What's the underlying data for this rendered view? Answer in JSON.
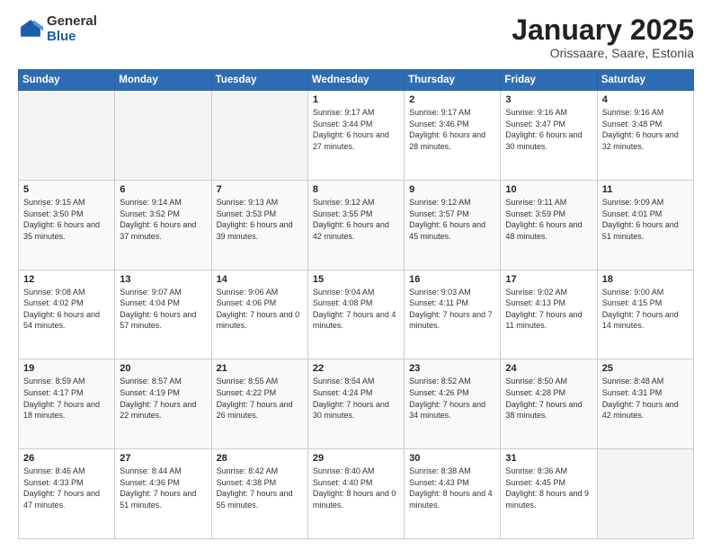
{
  "logo": {
    "general": "General",
    "blue": "Blue"
  },
  "header": {
    "title": "January 2025",
    "location": "Orissaare, Saare, Estonia"
  },
  "weekdays": [
    "Sunday",
    "Monday",
    "Tuesday",
    "Wednesday",
    "Thursday",
    "Friday",
    "Saturday"
  ],
  "weeks": [
    [
      {
        "day": "",
        "sunrise": "",
        "sunset": "",
        "daylight": ""
      },
      {
        "day": "",
        "sunrise": "",
        "sunset": "",
        "daylight": ""
      },
      {
        "day": "",
        "sunrise": "",
        "sunset": "",
        "daylight": ""
      },
      {
        "day": "1",
        "sunrise": "Sunrise: 9:17 AM",
        "sunset": "Sunset: 3:44 PM",
        "daylight": "Daylight: 6 hours and 27 minutes."
      },
      {
        "day": "2",
        "sunrise": "Sunrise: 9:17 AM",
        "sunset": "Sunset: 3:46 PM",
        "daylight": "Daylight: 6 hours and 28 minutes."
      },
      {
        "day": "3",
        "sunrise": "Sunrise: 9:16 AM",
        "sunset": "Sunset: 3:47 PM",
        "daylight": "Daylight: 6 hours and 30 minutes."
      },
      {
        "day": "4",
        "sunrise": "Sunrise: 9:16 AM",
        "sunset": "Sunset: 3:48 PM",
        "daylight": "Daylight: 6 hours and 32 minutes."
      }
    ],
    [
      {
        "day": "5",
        "sunrise": "Sunrise: 9:15 AM",
        "sunset": "Sunset: 3:50 PM",
        "daylight": "Daylight: 6 hours and 35 minutes."
      },
      {
        "day": "6",
        "sunrise": "Sunrise: 9:14 AM",
        "sunset": "Sunset: 3:52 PM",
        "daylight": "Daylight: 6 hours and 37 minutes."
      },
      {
        "day": "7",
        "sunrise": "Sunrise: 9:13 AM",
        "sunset": "Sunset: 3:53 PM",
        "daylight": "Daylight: 6 hours and 39 minutes."
      },
      {
        "day": "8",
        "sunrise": "Sunrise: 9:12 AM",
        "sunset": "Sunset: 3:55 PM",
        "daylight": "Daylight: 6 hours and 42 minutes."
      },
      {
        "day": "9",
        "sunrise": "Sunrise: 9:12 AM",
        "sunset": "Sunset: 3:57 PM",
        "daylight": "Daylight: 6 hours and 45 minutes."
      },
      {
        "day": "10",
        "sunrise": "Sunrise: 9:11 AM",
        "sunset": "Sunset: 3:59 PM",
        "daylight": "Daylight: 6 hours and 48 minutes."
      },
      {
        "day": "11",
        "sunrise": "Sunrise: 9:09 AM",
        "sunset": "Sunset: 4:01 PM",
        "daylight": "Daylight: 6 hours and 51 minutes."
      }
    ],
    [
      {
        "day": "12",
        "sunrise": "Sunrise: 9:08 AM",
        "sunset": "Sunset: 4:02 PM",
        "daylight": "Daylight: 6 hours and 54 minutes."
      },
      {
        "day": "13",
        "sunrise": "Sunrise: 9:07 AM",
        "sunset": "Sunset: 4:04 PM",
        "daylight": "Daylight: 6 hours and 57 minutes."
      },
      {
        "day": "14",
        "sunrise": "Sunrise: 9:06 AM",
        "sunset": "Sunset: 4:06 PM",
        "daylight": "Daylight: 7 hours and 0 minutes."
      },
      {
        "day": "15",
        "sunrise": "Sunrise: 9:04 AM",
        "sunset": "Sunset: 4:08 PM",
        "daylight": "Daylight: 7 hours and 4 minutes."
      },
      {
        "day": "16",
        "sunrise": "Sunrise: 9:03 AM",
        "sunset": "Sunset: 4:11 PM",
        "daylight": "Daylight: 7 hours and 7 minutes."
      },
      {
        "day": "17",
        "sunrise": "Sunrise: 9:02 AM",
        "sunset": "Sunset: 4:13 PM",
        "daylight": "Daylight: 7 hours and 11 minutes."
      },
      {
        "day": "18",
        "sunrise": "Sunrise: 9:00 AM",
        "sunset": "Sunset: 4:15 PM",
        "daylight": "Daylight: 7 hours and 14 minutes."
      }
    ],
    [
      {
        "day": "19",
        "sunrise": "Sunrise: 8:59 AM",
        "sunset": "Sunset: 4:17 PM",
        "daylight": "Daylight: 7 hours and 18 minutes."
      },
      {
        "day": "20",
        "sunrise": "Sunrise: 8:57 AM",
        "sunset": "Sunset: 4:19 PM",
        "daylight": "Daylight: 7 hours and 22 minutes."
      },
      {
        "day": "21",
        "sunrise": "Sunrise: 8:55 AM",
        "sunset": "Sunset: 4:22 PM",
        "daylight": "Daylight: 7 hours and 26 minutes."
      },
      {
        "day": "22",
        "sunrise": "Sunrise: 8:54 AM",
        "sunset": "Sunset: 4:24 PM",
        "daylight": "Daylight: 7 hours and 30 minutes."
      },
      {
        "day": "23",
        "sunrise": "Sunrise: 8:52 AM",
        "sunset": "Sunset: 4:26 PM",
        "daylight": "Daylight: 7 hours and 34 minutes."
      },
      {
        "day": "24",
        "sunrise": "Sunrise: 8:50 AM",
        "sunset": "Sunset: 4:28 PM",
        "daylight": "Daylight: 7 hours and 38 minutes."
      },
      {
        "day": "25",
        "sunrise": "Sunrise: 8:48 AM",
        "sunset": "Sunset: 4:31 PM",
        "daylight": "Daylight: 7 hours and 42 minutes."
      }
    ],
    [
      {
        "day": "26",
        "sunrise": "Sunrise: 8:46 AM",
        "sunset": "Sunset: 4:33 PM",
        "daylight": "Daylight: 7 hours and 47 minutes."
      },
      {
        "day": "27",
        "sunrise": "Sunrise: 8:44 AM",
        "sunset": "Sunset: 4:36 PM",
        "daylight": "Daylight: 7 hours and 51 minutes."
      },
      {
        "day": "28",
        "sunrise": "Sunrise: 8:42 AM",
        "sunset": "Sunset: 4:38 PM",
        "daylight": "Daylight: 7 hours and 55 minutes."
      },
      {
        "day": "29",
        "sunrise": "Sunrise: 8:40 AM",
        "sunset": "Sunset: 4:40 PM",
        "daylight": "Daylight: 8 hours and 0 minutes."
      },
      {
        "day": "30",
        "sunrise": "Sunrise: 8:38 AM",
        "sunset": "Sunset: 4:43 PM",
        "daylight": "Daylight: 8 hours and 4 minutes."
      },
      {
        "day": "31",
        "sunrise": "Sunrise: 8:36 AM",
        "sunset": "Sunset: 4:45 PM",
        "daylight": "Daylight: 8 hours and 9 minutes."
      },
      {
        "day": "",
        "sunrise": "",
        "sunset": "",
        "daylight": ""
      }
    ]
  ]
}
